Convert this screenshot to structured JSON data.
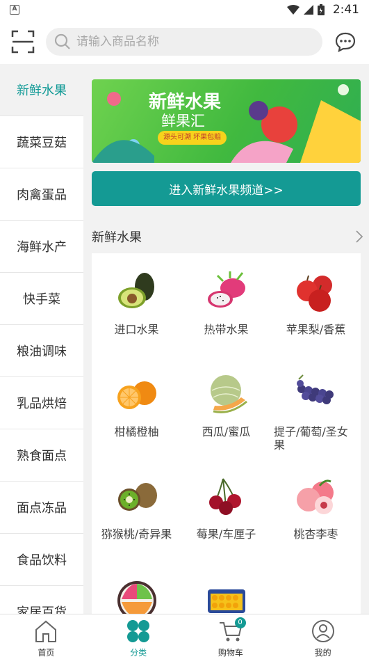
{
  "status_bar": {
    "app_badge": "A",
    "time": "2:41"
  },
  "search": {
    "placeholder": "请输入商品名称"
  },
  "sidebar": {
    "items": [
      {
        "label": "新鲜水果",
        "active": true
      },
      {
        "label": "蔬菜豆菇"
      },
      {
        "label": "肉禽蛋品"
      },
      {
        "label": "海鲜水产"
      },
      {
        "label": "快手菜"
      },
      {
        "label": "粮油调味"
      },
      {
        "label": "乳品烘焙"
      },
      {
        "label": "熟食面点"
      },
      {
        "label": "面点冻品"
      },
      {
        "label": "食品饮料"
      },
      {
        "label": "家居百货"
      }
    ]
  },
  "banner": {
    "title": "新鲜水果",
    "subtitle": "鲜果汇",
    "tag": "源头可溯  坏果包赔"
  },
  "channel_button": {
    "label": "进入新鲜水果频道>>"
  },
  "section": {
    "title": "新鲜水果"
  },
  "categories": [
    {
      "label": "进口水果",
      "icon": "avocado-icon"
    },
    {
      "label": "热带水果",
      "icon": "dragon-fruit-icon"
    },
    {
      "label": "苹果梨/香蕉",
      "icon": "apple-icon"
    },
    {
      "label": "柑橘橙柚",
      "icon": "orange-icon"
    },
    {
      "label": "西瓜/蜜瓜",
      "icon": "melon-icon"
    },
    {
      "label": "提子/葡萄/圣女果",
      "icon": "grape-icon"
    },
    {
      "label": "猕猴桃/奇异果",
      "icon": "kiwi-icon"
    },
    {
      "label": "莓果/车厘子",
      "icon": "cherry-icon"
    },
    {
      "label": "桃杏李枣",
      "icon": "peach-icon"
    },
    {
      "label": "",
      "icon": "fruit-bowl-icon"
    },
    {
      "label": "",
      "icon": "gift-box-icon"
    }
  ],
  "tabbar": {
    "items": [
      {
        "label": "首页",
        "icon": "home-icon"
      },
      {
        "label": "分类",
        "icon": "category-icon",
        "active": true
      },
      {
        "label": "购物车",
        "icon": "cart-icon",
        "badge": "0"
      },
      {
        "label": "我的",
        "icon": "profile-icon"
      }
    ]
  },
  "colors": {
    "accent": "#149a94",
    "background": "#f2f2f2"
  }
}
